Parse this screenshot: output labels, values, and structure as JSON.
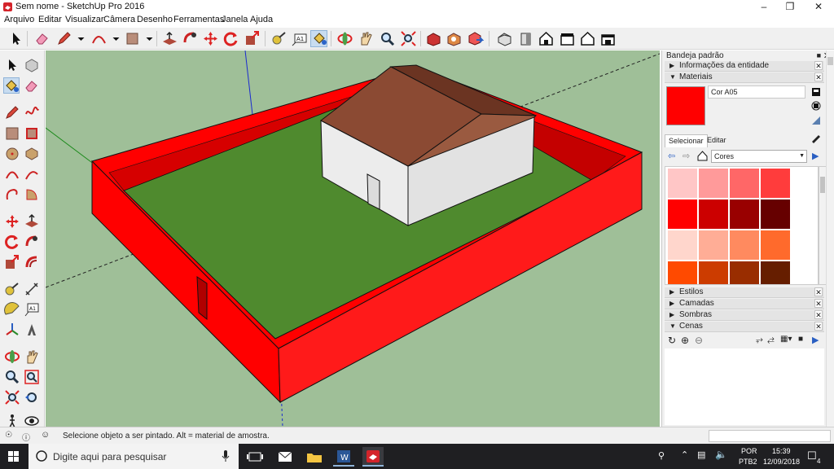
{
  "window": {
    "title": "Sem nome - SketchUp Pro 2016",
    "controls": [
      "minimize-icon",
      "restore-icon",
      "close-icon"
    ]
  },
  "menu": [
    "Arquivo",
    "Editar",
    "Visualizar",
    "Câmera",
    "Desenho",
    "Ferramentas",
    "Janela",
    "Ajuda"
  ],
  "toolbar": {
    "icons": [
      "select-icon",
      "eraser-icon",
      "pencil-icon",
      "dropdown-icon",
      "arc-icon",
      "dropdown-icon",
      "rectangle-icon",
      "dropdown-icon",
      "push-pull-icon",
      "follow-me-icon",
      "move-icon",
      "rotate-icon",
      "scale-icon",
      "tape-measure-icon",
      "text-icon",
      "paint-bucket-icon",
      "orbit-icon",
      "pan-icon",
      "zoom-icon",
      "zoom-extents-icon",
      "warehouse-icon",
      "extension-icon",
      "extension-manager-icon",
      "iso-view-icon",
      "front-view-icon",
      "home-icon",
      "right-view-icon",
      "back-view-icon",
      "left-view-icon"
    ],
    "active": "paint-bucket-icon"
  },
  "left_tools": [
    "select-icon",
    "make-component-icon",
    "paint-bucket-icon",
    "eraser-icon",
    "line-icon",
    "freehand-icon",
    "rectangle-icon",
    "rotated-rectangle-icon",
    "circle-icon",
    "polygon-icon",
    "arc-icon",
    "arc-2pt-icon",
    "arc-3pt-icon",
    "pie-icon",
    "move-icon",
    "push-pull-icon",
    "rotate-icon",
    "follow-me-icon",
    "scale-icon",
    "offset-icon",
    "tape-measure-icon",
    "dimension-icon",
    "protractor-icon",
    "text-icon",
    "axes-icon",
    "3d-text-icon",
    "orbit-icon",
    "pan-icon",
    "zoom-icon",
    "zoom-window-icon",
    "zoom-extents-icon",
    "previous-icon",
    "walk-icon",
    "look-around-icon"
  ],
  "tray": {
    "title": "Bandeja padrão",
    "sections_top": [
      {
        "label": "Informações da entidade",
        "expanded": false
      },
      {
        "label": "Materiais",
        "expanded": true
      }
    ],
    "material": {
      "name": "Cor A05",
      "color": "#ff0000",
      "tabs": [
        "Selecionar",
        "Editar"
      ],
      "active_tab": "Selecionar",
      "library": "Cores",
      "swatches": [
        [
          "#ffc6c6",
          "#ff9a9a",
          "#ff6767",
          "#ff3c3c"
        ],
        [
          "#ff0000",
          "#cc0000",
          "#990000",
          "#660000"
        ],
        [
          "#ffd6cc",
          "#ffad96",
          "#ff8a5f",
          "#ff6a2c"
        ],
        [
          "#ff4a00",
          "#cc3c00",
          "#992d00",
          "#661e00"
        ]
      ]
    },
    "sections_bottom": [
      {
        "label": "Estilos",
        "expanded": false
      },
      {
        "label": "Camadas",
        "expanded": false
      },
      {
        "label": "Sombras",
        "expanded": false
      },
      {
        "label": "Cenas",
        "expanded": true
      }
    ]
  },
  "status": {
    "message": "Selecione objeto a ser pintado. Alt = material de amostra.",
    "measurements": ""
  },
  "taskbar": {
    "search_placeholder": "Digite aqui para pesquisar",
    "lang_top": "POR",
    "lang_bottom": "PTB2",
    "time": "15:39",
    "date": "12/09/2018",
    "notification_count": "4"
  },
  "scene": {
    "sky_ground_color": "#9fbf98",
    "wall_color": "#ff0000",
    "lawn_color": "#4f8a2e",
    "roof_color": "#8b4a33",
    "house_wall_color": "#ececec"
  }
}
